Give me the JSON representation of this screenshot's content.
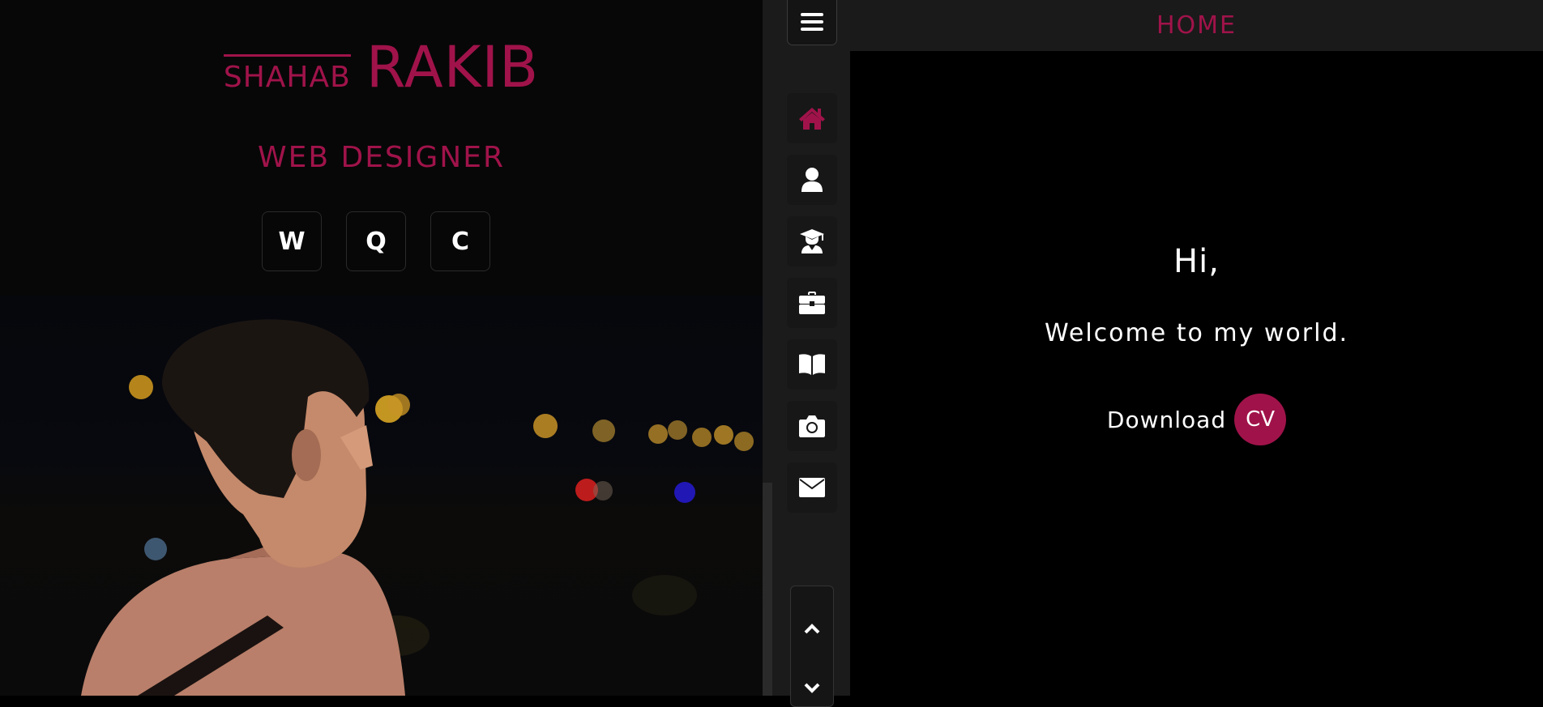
{
  "colors": {
    "accent": "#a0134a",
    "panel": "#1b1b1b",
    "background": "#000000"
  },
  "profile": {
    "first_name": "SHAHAB",
    "last_name": "RAKIB",
    "role": "WEB DESIGNER",
    "social": [
      {
        "label": "W"
      },
      {
        "label": "Q"
      },
      {
        "label": "C"
      }
    ]
  },
  "nav": {
    "toggle_icon": "hamburger-icon",
    "items": [
      {
        "icon": "home-icon",
        "active": true
      },
      {
        "icon": "user-icon",
        "active": false
      },
      {
        "icon": "graduate-icon",
        "active": false
      },
      {
        "icon": "briefcase-icon",
        "active": false
      },
      {
        "icon": "book-icon",
        "active": false
      },
      {
        "icon": "camera-icon",
        "active": false
      },
      {
        "icon": "envelope-icon",
        "active": false
      }
    ],
    "scroll": {
      "up_icon": "chevron-up-icon",
      "down_icon": "chevron-down-icon"
    }
  },
  "header": {
    "title": "HOME"
  },
  "hero": {
    "greeting": "Hi,",
    "welcome": "Welcome to my world.",
    "download_label": "Download",
    "cv_label": "CV"
  }
}
